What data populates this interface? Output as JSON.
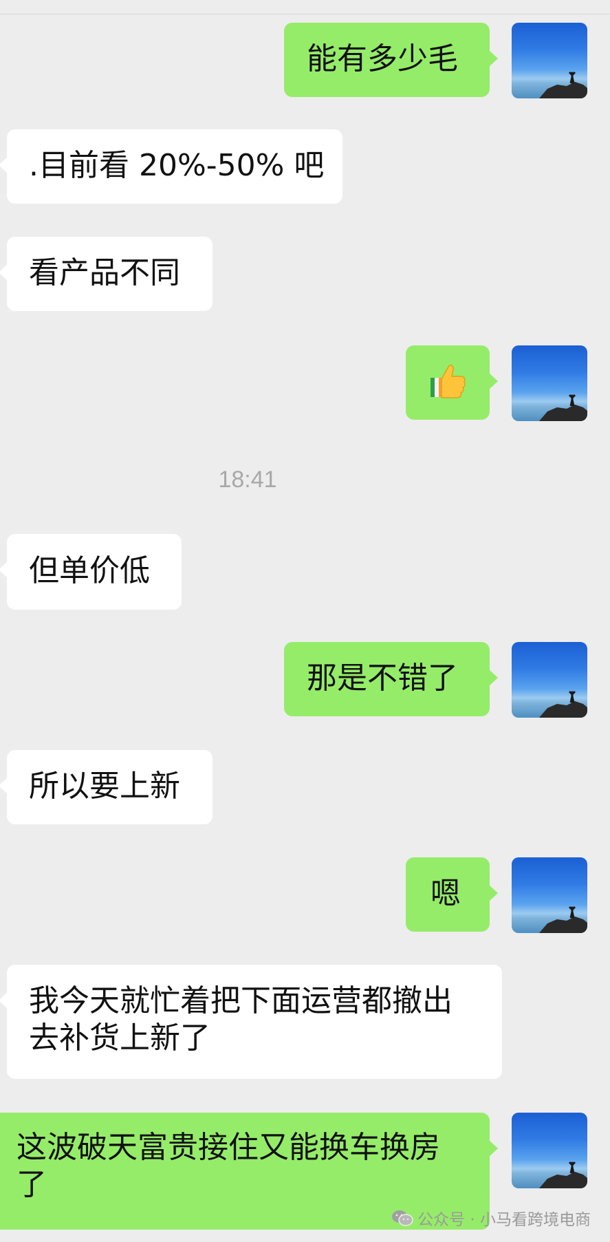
{
  "time_divider": "18:41",
  "messages": [
    {
      "dir": "out",
      "text": "能有多少毛"
    },
    {
      "dir": "in",
      "text": ".目前看 20%-50% 吧"
    },
    {
      "dir": "in",
      "text": "看产品不同"
    },
    {
      "dir": "out",
      "emoji": "thumbs-up-icon",
      "text": "👍"
    },
    {
      "dir": "in",
      "text": "但单价低"
    },
    {
      "dir": "out",
      "text": "那是不错了"
    },
    {
      "dir": "in",
      "text": "所以要上新"
    },
    {
      "dir": "out",
      "text": "嗯"
    },
    {
      "dir": "in",
      "text": "我今天就忙着把下面运营都撤出",
      "text2": "去补货上新了"
    },
    {
      "dir": "out",
      "text": "这波破天富贵接住又能换车换房",
      "text2": "了"
    }
  ],
  "watermark": "公众号 · 小马看跨境电商",
  "colors": {
    "background": "#ededed",
    "incoming": "#ffffff",
    "outgoing": "#95ec69"
  }
}
